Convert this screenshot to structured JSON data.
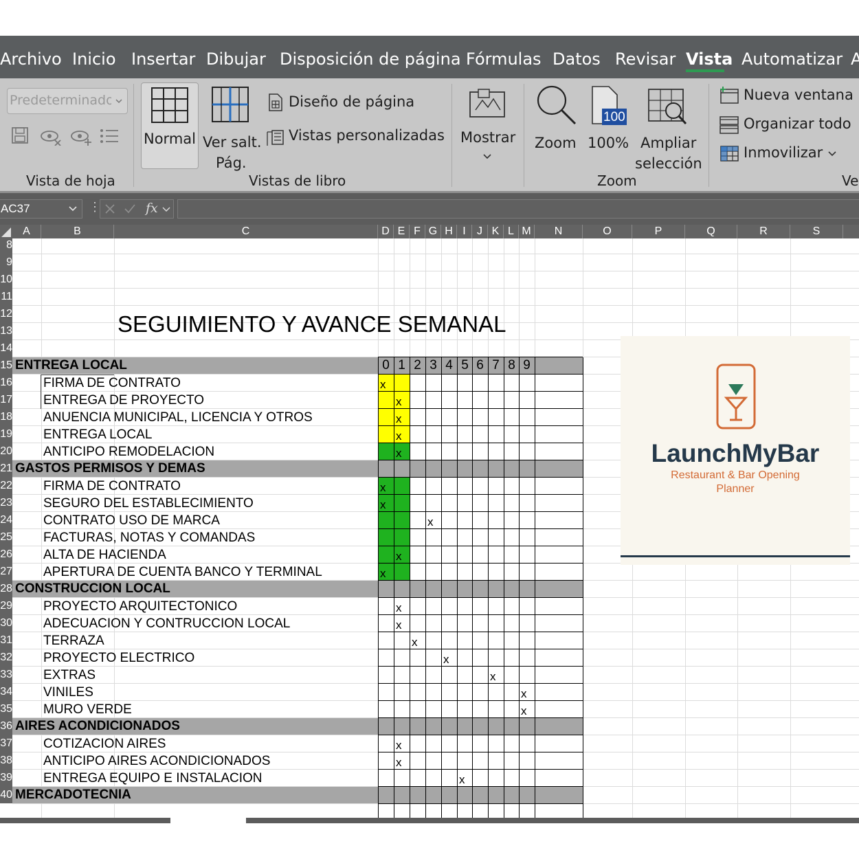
{
  "menu": {
    "tabs": [
      "Archivo",
      "Inicio",
      "Insertar",
      "Dibujar",
      "Disposición de página",
      "Fórmulas",
      "Datos",
      "Revisar",
      "Vista",
      "Automatizar",
      "A"
    ],
    "active_tab": "Vista"
  },
  "ribbon": {
    "sheet_view_dropdown": "Predeterminado",
    "groups": {
      "vista_de_hoja": "Vista de hoja",
      "vistas_de_libro": "Vistas de libro",
      "zoom": "Zoom",
      "ventana": "Ver"
    },
    "buttons": {
      "normal": "Normal",
      "ver_salt_1": "Ver salt.",
      "ver_salt_2": "Pág.",
      "diseno_pagina": "Diseño de página",
      "vistas_personalizadas": "Vistas personalizadas",
      "mostrar": "Mostrar",
      "zoom": "Zoom",
      "zoom_100": "100%",
      "zoom_100_icon_text": "100",
      "ampliar_1": "Ampliar",
      "ampliar_2": "selección",
      "nueva_ventana": "Nueva ventana",
      "organizar_todo": "Organizar todo",
      "inmovilizar": "Inmovilizar"
    }
  },
  "formula_bar": {
    "name_box": "AC37",
    "fx": "fx",
    "formula": ""
  },
  "columns": [
    "A",
    "B",
    "C",
    "D",
    "E",
    "F",
    "G",
    "H",
    "I",
    "J",
    "K",
    "L",
    "M",
    "N",
    "O",
    "P",
    "Q",
    "R",
    "S"
  ],
  "row_headers": [
    "8",
    "9",
    "10",
    "11",
    "12",
    "13",
    "14",
    "15",
    "16",
    "17",
    "18",
    "19",
    "20",
    "21",
    "22",
    "23",
    "24",
    "25",
    "26",
    "27",
    "28",
    "29",
    "30",
    "31",
    "32",
    "33",
    "34",
    "35",
    "36",
    "37",
    "38",
    "39",
    "40"
  ],
  "sheet": {
    "title": "SEGUIMIENTO Y AVANCE SEMANAL",
    "timeline_numbers": [
      "0",
      "1",
      "2",
      "3",
      "4",
      "5",
      "6",
      "7",
      "8",
      "9"
    ],
    "sections": [
      {
        "name": "ENTREGA LOCAL",
        "tasks": [
          {
            "name": "FIRMA DE CONTRATO",
            "mark_col": 0,
            "fill": "yellow"
          },
          {
            "name": "ENTREGA DE PROYECTO",
            "mark_col": 1,
            "fill": "yellow"
          },
          {
            "name": "ANUENCIA MUNICIPAL, LICENCIA Y OTROS",
            "mark_col": 1,
            "fill": "yellow"
          },
          {
            "name": "ENTREGA LOCAL",
            "mark_col": 1,
            "fill": "yellow"
          },
          {
            "name": "ANTICIPO REMODELACION",
            "mark_col": 1,
            "fill": "green"
          }
        ]
      },
      {
        "name": "GASTOS PERMISOS Y DEMAS",
        "tasks": [
          {
            "name": "FIRMA DE CONTRATO",
            "mark_col": 0,
            "fill": "green"
          },
          {
            "name": "SEGURO DEL ESTABLECIMIENTO",
            "mark_col": 0,
            "fill": "green"
          },
          {
            "name": "CONTRATO USO DE MARCA",
            "mark_col": 3,
            "fill": "green"
          },
          {
            "name": "FACTURAS, NOTAS Y COMANDAS",
            "mark_col": -1,
            "fill": "green"
          },
          {
            "name": "ALTA DE HACIENDA",
            "mark_col": 1,
            "fill": "green"
          },
          {
            "name": "APERTURA DE CUENTA BANCO Y TERMINAL",
            "mark_col": 0,
            "fill": "green"
          }
        ]
      },
      {
        "name": "CONSTRUCCION LOCAL",
        "tasks": [
          {
            "name": "PROYECTO ARQUITECTONICO",
            "mark_col": 1,
            "fill": "none"
          },
          {
            "name": "ADECUACION Y CONTRUCCION LOCAL",
            "mark_col": 1,
            "fill": "none"
          },
          {
            "name": "TERRAZA",
            "mark_col": 2,
            "fill": "none"
          },
          {
            "name": "PROYECTO ELECTRICO",
            "mark_col": 4,
            "fill": "none"
          },
          {
            "name": "EXTRAS",
            "mark_col": 7,
            "fill": "none"
          },
          {
            "name": "VINILES",
            "mark_col": 9,
            "fill": "none"
          },
          {
            "name": "MURO VERDE",
            "mark_col": 9,
            "fill": "none"
          }
        ]
      },
      {
        "name": "AIRES ACONDICIONADOS",
        "tasks": [
          {
            "name": "COTIZACION AIRES",
            "mark_col": 1,
            "fill": "none"
          },
          {
            "name": "ANTICIPO AIRES ACONDICIONADOS",
            "mark_col": 1,
            "fill": "none"
          },
          {
            "name": "ENTREGA EQUIPO E INSTALACION",
            "mark_col": 5,
            "fill": "none"
          }
        ]
      },
      {
        "name": "MERCADOTECNIA",
        "tasks": []
      }
    ],
    "mark_symbol": "x"
  },
  "logo": {
    "name": "LaunchMyBar",
    "tagline_1": "Restaurant & Bar Opening",
    "tagline_2": "Planner"
  },
  "colors": {
    "yellow_fill": "#ffff00",
    "green_fill": "#1fb21f",
    "section_band": "#a6a6a6",
    "logo_orange": "#d36b36",
    "logo_navy": "#25394a",
    "logo_green": "#2d7a5b",
    "menu_bg": "#5a5d5f",
    "ribbon_bg": "#c7c7c7",
    "active_tab_underline": "#2e9a52"
  }
}
